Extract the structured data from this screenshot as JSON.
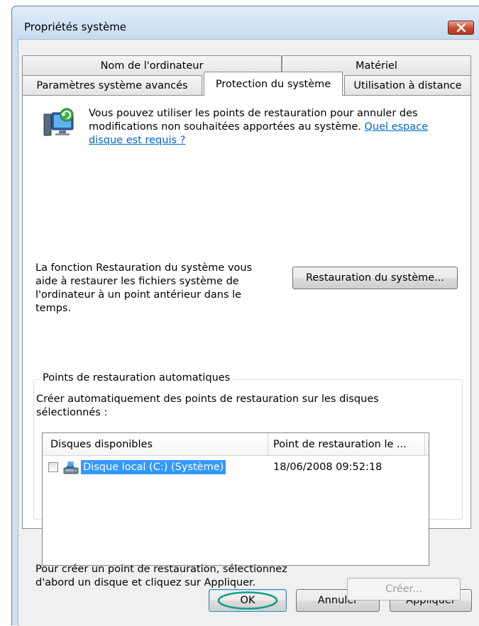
{
  "window": {
    "title": "Propriétés système",
    "close_icon": "close-icon"
  },
  "tabs": {
    "row_top": [
      "Nom de l'ordinateur",
      "Matériel"
    ],
    "row_bottom": [
      "Paramètres système avancés",
      "Protection du système",
      "Utilisation à distance"
    ],
    "active": "Protection du système"
  },
  "intro": {
    "icon": "system-restore-icon",
    "text": "Vous pouvez utiliser les points de restauration pour annuler des modifications non souhaitées apportées au système.",
    "link": "Quel espace disque est requis ?"
  },
  "restore": {
    "description": "La fonction Restauration du système vous aide à restaurer les fichiers système de l'ordinateur à un point antérieur dans le temps.",
    "button": "Restauration du système..."
  },
  "auto_points": {
    "legend": "Points de restauration automatiques",
    "description": "Créer automatiquement des points de restauration sur les disques sélectionnés :",
    "columns": [
      "Disques disponibles",
      "Point de restauration le ..."
    ],
    "rows": [
      {
        "checked": false,
        "icon": "drive-icon",
        "name": "Disque local (C:) (Système)",
        "restore_point": "18/06/2008 09:52:18",
        "selected": true
      }
    ]
  },
  "create": {
    "description": "Pour créer un point de restauration, sélectionnez d'abord un disque et cliquez sur Appliquer.",
    "button": "Créer..."
  },
  "footer": {
    "ok": "OK",
    "cancel": "Annuler",
    "apply": "Appliquer"
  },
  "colors": {
    "accent_link": "#0066cc",
    "selection": "#3399ff",
    "close_button": "#c7482c",
    "ok_highlight": "#1a9b8a"
  }
}
